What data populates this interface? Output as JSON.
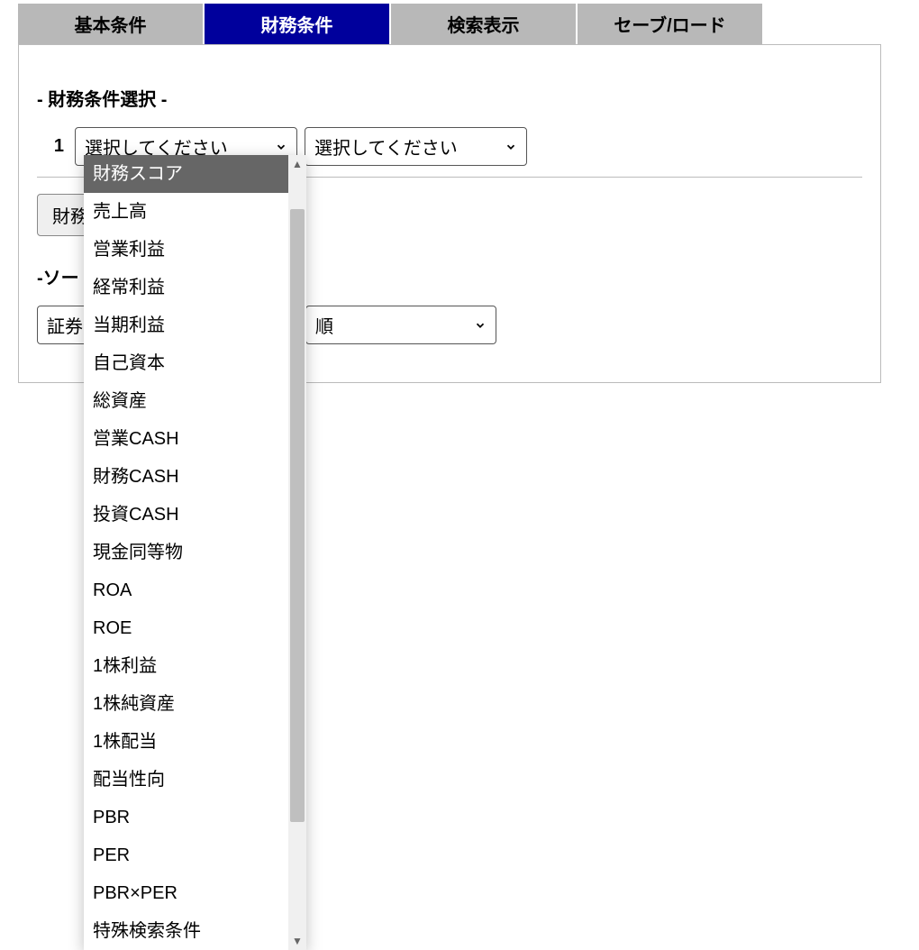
{
  "tabs": [
    {
      "label": "基本条件"
    },
    {
      "label": "財務条件"
    },
    {
      "label": "検索表示"
    },
    {
      "label": "セーブ/ロード"
    }
  ],
  "active_tab_index": 1,
  "section": {
    "title": "- 財務条件選択 -",
    "row_index": "1",
    "select1_value": "選択してください",
    "select2_value": "選択してください"
  },
  "button": {
    "add_label_prefix": "財務"
  },
  "sort": {
    "title_prefix": "-ソー",
    "select1_prefix": "証券",
    "select2_visible": "順"
  },
  "dropdown": {
    "options": [
      "財務スコア",
      "売上高",
      "営業利益",
      "経常利益",
      "当期利益",
      "自己資本",
      "総資産",
      "営業CASH",
      "財務CASH",
      "投資CASH",
      "現金同等物",
      "ROA",
      "ROE",
      "1株利益",
      "1株純資産",
      "1株配当",
      "配当性向",
      "PBR",
      "PER",
      "PBR×PER",
      "特殊検索条件"
    ],
    "highlight_index": 0
  }
}
